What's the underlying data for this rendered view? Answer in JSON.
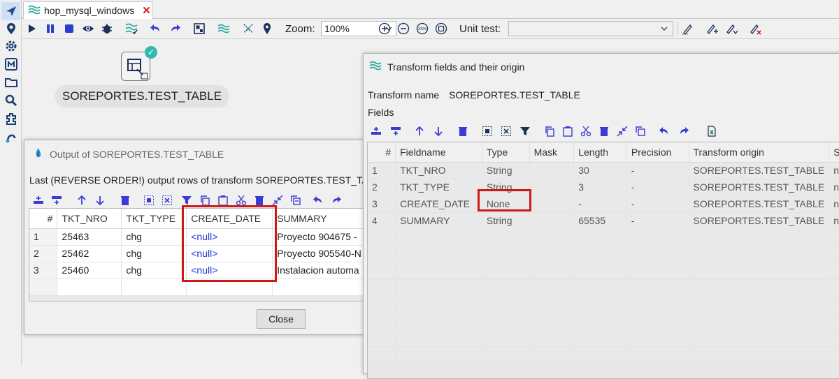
{
  "sidebar": {
    "icons": [
      "execution-icon",
      "location-icon",
      "settings-icon",
      "metadata-icon",
      "folder-icon",
      "search-icon",
      "plugin-icon",
      "git-icon"
    ]
  },
  "tab": {
    "title": "hop_mysql_windows",
    "close": "✕"
  },
  "toolbar": {
    "zoom_label": "Zoom:",
    "zoom_value": "100%",
    "zoom_100_icon": "100%",
    "unit_test_label": "Unit test:",
    "unit_test_value": ""
  },
  "canvas": {
    "node_label": "SOREPORTES.TEST_TABLE"
  },
  "output_dialog": {
    "title": "Output of SOREPORTES.TEST_TABLE",
    "caption": "Last (REVERSE ORDER!) output rows of transform SOREPORTES.TEST_TABLE",
    "columns": [
      "#",
      "TKT_NRO",
      "TKT_TYPE",
      "CREATE_DATE",
      "SUMMARY"
    ],
    "rows": [
      {
        "n": "1",
        "tkt_nro": "25463",
        "tkt_type": "chg",
        "create_date": "<null>",
        "summary": "Proyecto 904675 - "
      },
      {
        "n": "2",
        "tkt_nro": "25462",
        "tkt_type": "chg",
        "create_date": "<null>",
        "summary": "Proyecto 905540-N"
      },
      {
        "n": "3",
        "tkt_nro": "25460",
        "tkt_type": "chg",
        "create_date": "<null>",
        "summary": "Instalacion automa"
      }
    ],
    "close_label": "Close"
  },
  "fields_dialog": {
    "title": "Transform fields and their origin",
    "transform_name_label": "Transform name",
    "transform_name_value": "SOREPORTES.TEST_TABLE",
    "fields_label": "Fields",
    "columns": [
      "#",
      "Fieldname",
      "Type",
      "Mask",
      "Length",
      "Precision",
      "Transform origin",
      "S"
    ],
    "rows": [
      {
        "n": "1",
        "fieldname": "TKT_NRO",
        "type": "String",
        "mask": "",
        "length": "30",
        "precision": "-",
        "origin": "SOREPORTES.TEST_TABLE",
        "s": "n"
      },
      {
        "n": "2",
        "fieldname": "TKT_TYPE",
        "type": "String",
        "mask": "",
        "length": "3",
        "precision": "-",
        "origin": "SOREPORTES.TEST_TABLE",
        "s": "n"
      },
      {
        "n": "3",
        "fieldname": "CREATE_DATE",
        "type": "None",
        "mask": "",
        "length": "-",
        "precision": "-",
        "origin": "SOREPORTES.TEST_TABLE",
        "s": "n"
      },
      {
        "n": "4",
        "fieldname": "SUMMARY",
        "type": "String",
        "mask": "",
        "length": "65535",
        "precision": "-",
        "origin": "SOREPORTES.TEST_TABLE",
        "s": "n"
      }
    ]
  },
  "colors": {
    "accent": "#3b3bd6",
    "highlight_box": "#d01818",
    "null_text": "#2233cc",
    "teal": "#35b8b0"
  }
}
